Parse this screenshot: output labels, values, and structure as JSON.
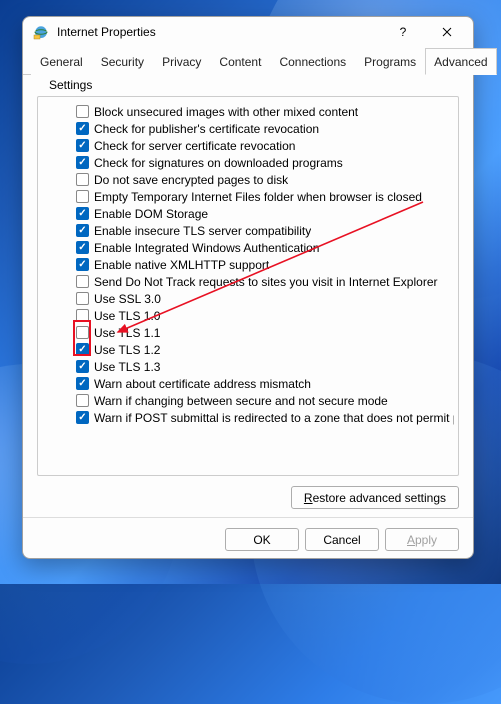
{
  "window": {
    "title": "Internet Properties"
  },
  "tabs": [
    {
      "label": "General"
    },
    {
      "label": "Security"
    },
    {
      "label": "Privacy"
    },
    {
      "label": "Content"
    },
    {
      "label": "Connections"
    },
    {
      "label": "Programs"
    },
    {
      "label": "Advanced",
      "active": true
    }
  ],
  "settings": {
    "fieldset_label": "Settings",
    "items": [
      {
        "checked": false,
        "label": "Block unsecured images with other mixed content"
      },
      {
        "checked": true,
        "label": "Check for publisher's certificate revocation"
      },
      {
        "checked": true,
        "label": "Check for server certificate revocation"
      },
      {
        "checked": true,
        "label": "Check for signatures on downloaded programs"
      },
      {
        "checked": false,
        "label": "Do not save encrypted pages to disk"
      },
      {
        "checked": false,
        "label": "Empty Temporary Internet Files folder when browser is closed"
      },
      {
        "checked": true,
        "label": "Enable DOM Storage"
      },
      {
        "checked": true,
        "label": "Enable insecure TLS server compatibility"
      },
      {
        "checked": true,
        "label": "Enable Integrated Windows Authentication"
      },
      {
        "checked": true,
        "label": "Enable native XMLHTTP support"
      },
      {
        "checked": false,
        "label": "Send Do Not Track requests to sites you visit in Internet Explorer"
      },
      {
        "checked": false,
        "label": "Use SSL 3.0"
      },
      {
        "checked": false,
        "label": "Use TLS 1.0"
      },
      {
        "checked": false,
        "label": "Use TLS 1.1"
      },
      {
        "checked": true,
        "label": "Use TLS 1.2",
        "highlight": true
      },
      {
        "checked": true,
        "label": "Use TLS 1.3",
        "highlight": true
      },
      {
        "checked": true,
        "label": "Warn about certificate address mismatch"
      },
      {
        "checked": false,
        "label": "Warn if changing between secure and not secure mode"
      },
      {
        "checked": true,
        "label": "Warn if POST submittal is redirected to a zone that does not permit posts"
      }
    ]
  },
  "buttons": {
    "restore": "Restore advanced settings",
    "ok": "OK",
    "cancel": "Cancel",
    "apply": "Apply"
  }
}
